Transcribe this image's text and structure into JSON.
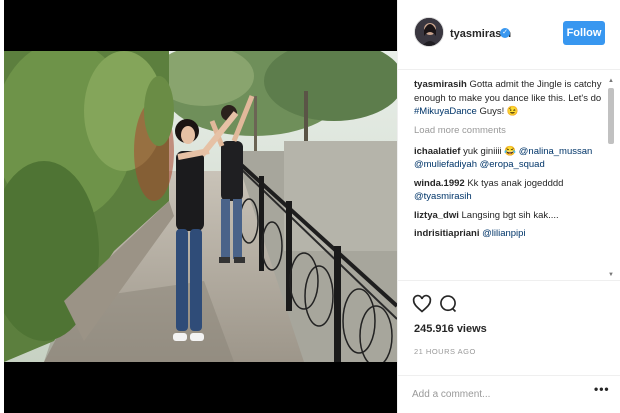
{
  "post": {
    "username": "tyasmirasih",
    "follow_label": "Follow",
    "caption_user": "tyasmirasih",
    "caption_text": "Gotta admit the Jingle is catchy enough to make you dance like this. Let's do",
    "caption_tag": "#MikuyaDance",
    "caption_end": "Guys! 😉",
    "load_more": "Load more comments"
  },
  "comments": [
    {
      "user": "ichaalatief",
      "text": "yuk giniiii 😂",
      "tags": "@nalina_mussan @muliefadiyah @eropa_squad"
    },
    {
      "user": "winda.1992",
      "text": "Kk tyas anak jogedddd",
      "tags": "@tyasmirasih"
    },
    {
      "user": "liztya_dwi",
      "text": "Langsing bgt sih kak....",
      "tags": ""
    },
    {
      "user": "indrisitiapriani",
      "text": "",
      "tags": "@lilianpipi"
    }
  ],
  "stats": {
    "views": "245.916 views",
    "time": "21 HOURS AGO"
  },
  "compose": {
    "placeholder": "Add a comment...",
    "more": "•••"
  },
  "colors": {
    "accent": "#3897f0",
    "link": "#003569",
    "muted": "#999999"
  },
  "icons": {
    "like": "heart-icon",
    "comment": "comment-icon",
    "verified": "verified-badge-icon"
  }
}
